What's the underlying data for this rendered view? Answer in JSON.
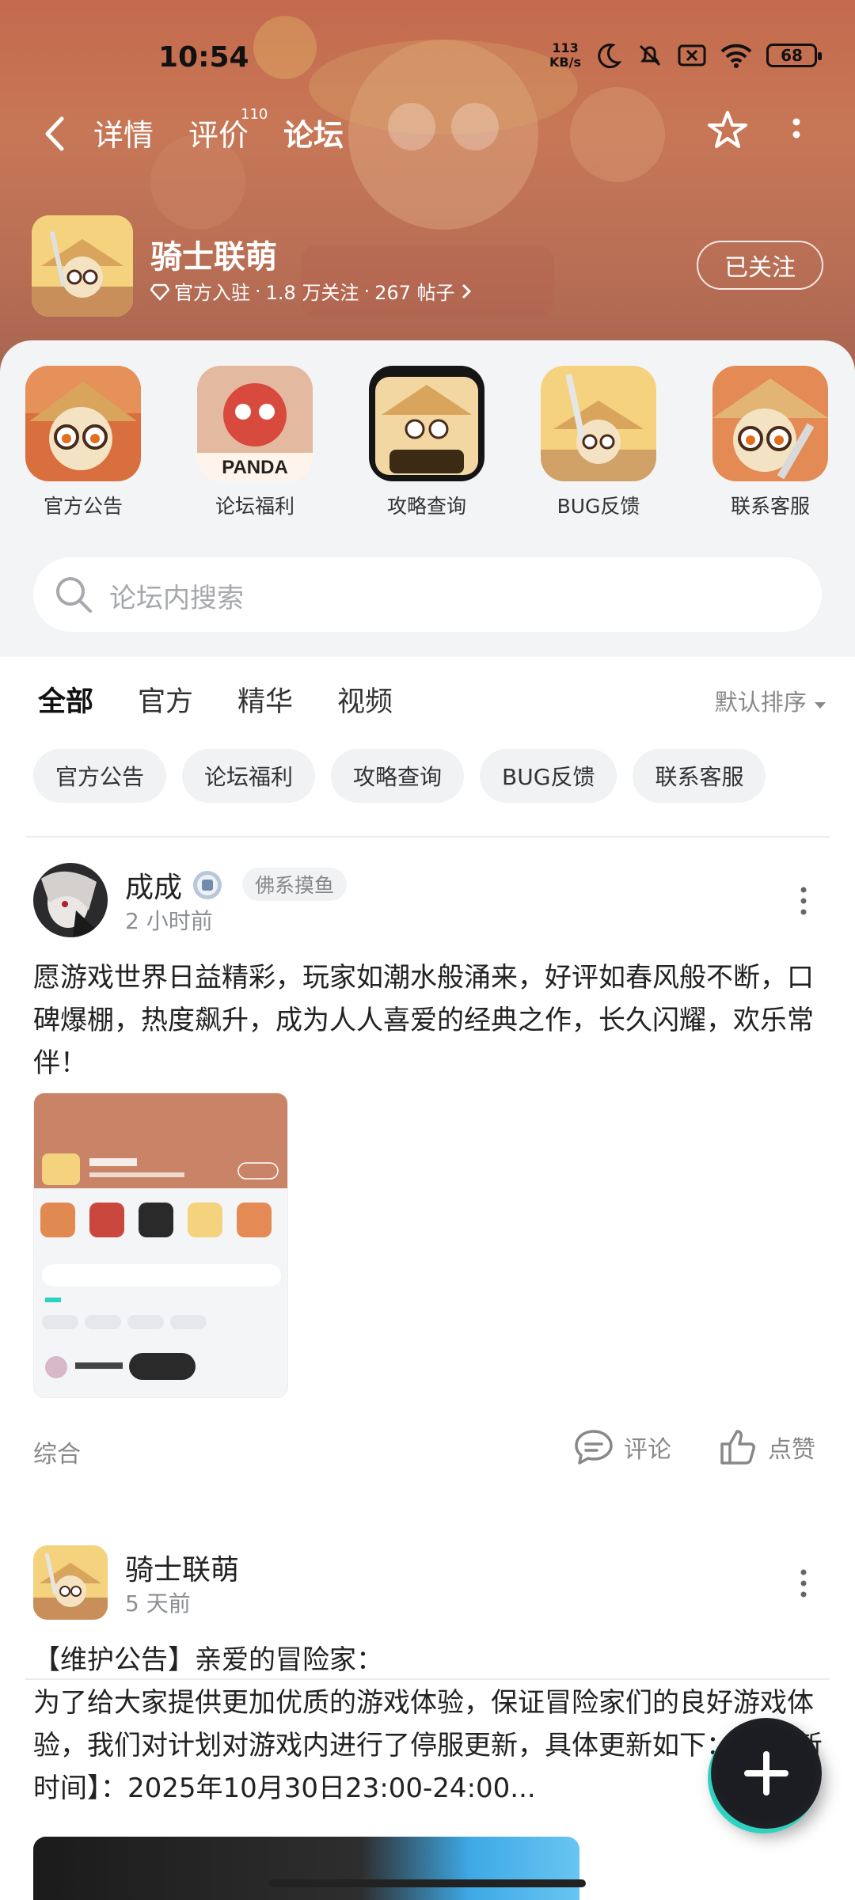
{
  "status_bar": {
    "time": "10:54",
    "net_speed_value": "113",
    "net_speed_unit": "KB/s",
    "battery": "68"
  },
  "nav": {
    "tabs": [
      {
        "label": "详情"
      },
      {
        "label": "评价",
        "badge": "110"
      },
      {
        "label": "论坛"
      }
    ]
  },
  "forum": {
    "name": "骑士联萌",
    "official": "官方入驻",
    "followers": "1.8 万关注",
    "posts": "267 帖子",
    "sep": "·",
    "follow_button": "已关注"
  },
  "shortcuts": [
    {
      "label": "官方公告"
    },
    {
      "label": "论坛福利"
    },
    {
      "label": "攻略查询"
    },
    {
      "label": "BUG反馈"
    },
    {
      "label": "联系客服"
    }
  ],
  "shortcut_art_text": "PANDA",
  "search": {
    "placeholder": "论坛内搜索"
  },
  "feed_tabs": [
    {
      "label": "全部"
    },
    {
      "label": "官方"
    },
    {
      "label": "精华"
    },
    {
      "label": "视频"
    }
  ],
  "sort_label": "默认排序",
  "chips": [
    "官方公告",
    "论坛福利",
    "攻略查询",
    "BUG反馈",
    "联系客服"
  ],
  "posts": [
    {
      "author": "成成",
      "tag": "佛系摸鱼",
      "time": "2 小时前",
      "text": "愿游戏世界日益精彩，玩家如潮水般涌来，好评如春风般不断，口碑爆棚，热度飙升，成为人人喜爱的经典之作，长久闪耀，欢乐常伴！",
      "category": "综合",
      "comment_label": "评论",
      "like_label": "点赞"
    },
    {
      "author": "骑士联萌",
      "time": "5 天前",
      "text_line1": "【维护公告】亲爱的冒险家：",
      "text_rest": "为了给大家提供更加优质的游戏体验，保证冒险家们的良好游戏体验，我们对计划对游戏内进行了停服更新，具体更新如下：  【更新时间】：2025年10月30日23:00-24:00..."
    }
  ],
  "colors": {
    "accent": "#2ed3c0",
    "banner": "#c46a4e",
    "sheet_bg": "#f3f4f6"
  }
}
